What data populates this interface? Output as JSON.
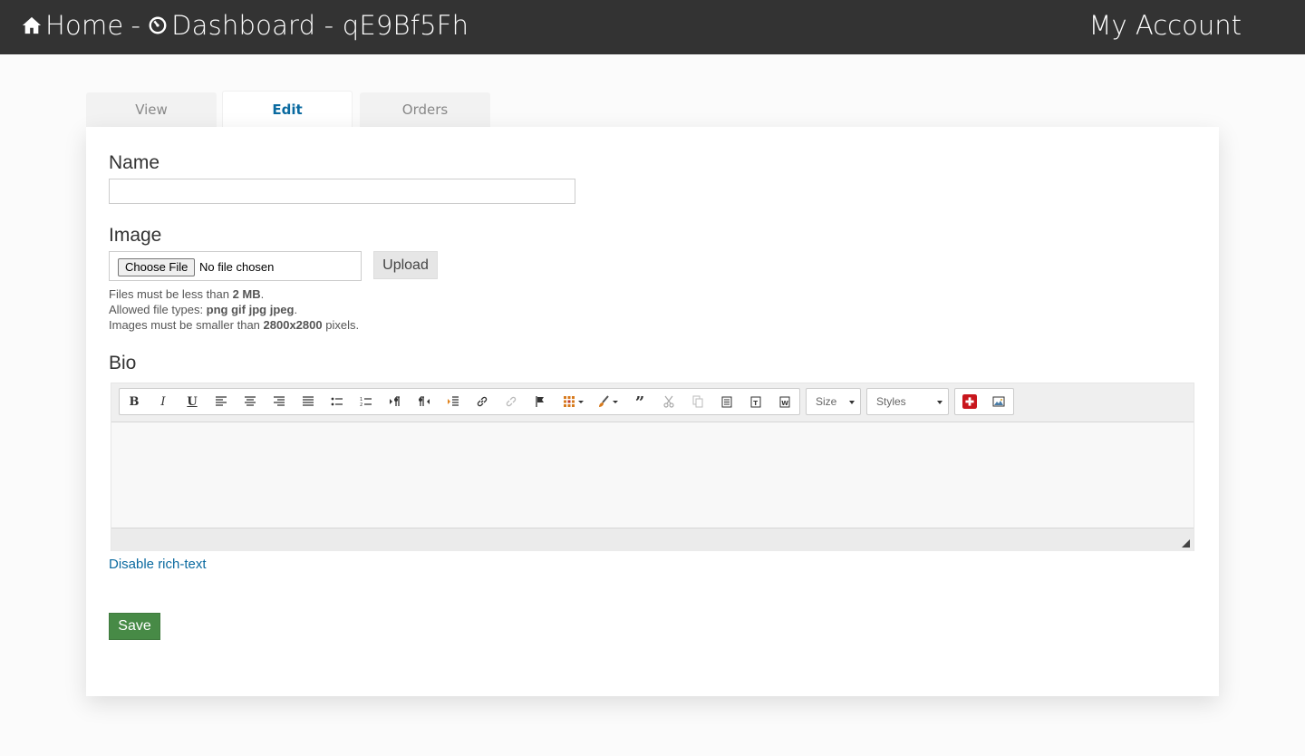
{
  "header": {
    "home_label": "Home",
    "separator": "-",
    "dashboard_label": "Dashboard - qE9Bf5Fh",
    "account_label": "My Account"
  },
  "tabs": [
    {
      "label": "View",
      "active": false
    },
    {
      "label": "Edit",
      "active": true
    },
    {
      "label": "Orders",
      "active": false
    }
  ],
  "form": {
    "name_label": "Name",
    "name_value": "",
    "image_label": "Image",
    "choose_file_label": "Choose File",
    "no_file_text": "No file chosen",
    "upload_label": "Upload",
    "help": {
      "size_prefix": "Files must be less than ",
      "size_value": "2 MB",
      "size_suffix": ".",
      "types_prefix": "Allowed file types: ",
      "types_value": "png gif jpg jpeg",
      "types_suffix": ".",
      "dims_prefix": "Images must be smaller than ",
      "dims_value": "2800x2800",
      "dims_suffix": " pixels."
    },
    "bio_label": "Bio",
    "size_combo": "Size",
    "styles_combo": "Styles",
    "disable_richtext_label": "Disable rich-text",
    "save_label": "Save"
  },
  "colors": {
    "topbar": "#333333",
    "link": "#0a6aa0",
    "save": "#478a46"
  }
}
